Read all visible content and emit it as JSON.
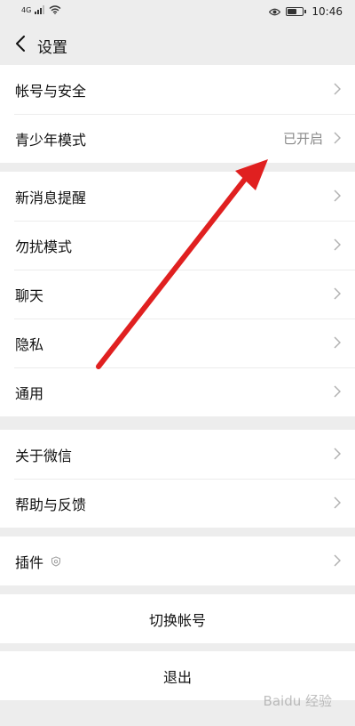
{
  "status_bar": {
    "network": "4G",
    "time": "10:46",
    "battery_level": 0.6
  },
  "nav": {
    "back_icon": "chevron-left-icon",
    "title": "设置"
  },
  "groups": [
    {
      "items": [
        {
          "label": "帐号与安全",
          "value": ""
        },
        {
          "label": "青少年模式",
          "value": "已开启"
        }
      ]
    },
    {
      "items": [
        {
          "label": "新消息提醒",
          "value": ""
        },
        {
          "label": "勿扰模式",
          "value": ""
        },
        {
          "label": "聊天",
          "value": ""
        },
        {
          "label": "隐私",
          "value": ""
        },
        {
          "label": "通用",
          "value": ""
        }
      ]
    },
    {
      "items": [
        {
          "label": "关于微信",
          "value": ""
        },
        {
          "label": "帮助与反馈",
          "value": ""
        }
      ]
    },
    {
      "items": [
        {
          "label": "插件",
          "value": "",
          "icon": "shield-icon"
        }
      ]
    }
  ],
  "actions": {
    "switch_account": "切换帐号",
    "logout": "退出"
  },
  "annotation": {
    "arrow_color": "#e02020"
  },
  "watermark": {
    "text": "Baidu 经验"
  }
}
